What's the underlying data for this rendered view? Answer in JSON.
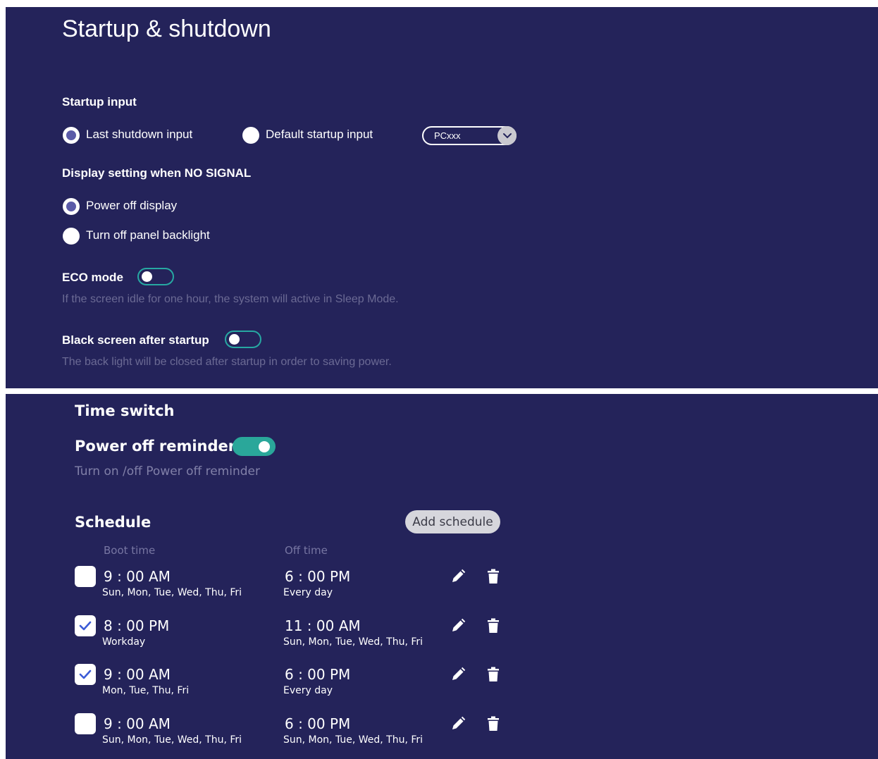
{
  "startup": {
    "title": "Startup & shutdown",
    "startup_input": {
      "label": "Startup input",
      "options": [
        {
          "label": "Last shutdown input",
          "checked": true
        },
        {
          "label": "Default startup input",
          "checked": false
        }
      ],
      "select_value": "PCxxx"
    },
    "no_signal": {
      "label": "Display setting when NO SIGNAL",
      "options": [
        {
          "label": "Power off display",
          "checked": true
        },
        {
          "label": "Turn off panel backlight",
          "checked": false
        }
      ]
    },
    "eco": {
      "label": "ECO mode",
      "enabled": false,
      "hint": "If the screen idle for one hour, the system will active in Sleep Mode."
    },
    "black_screen": {
      "label": "Black screen after startup",
      "enabled": false,
      "hint": "The back light will be closed after startup in order to saving power."
    }
  },
  "time_switch": {
    "title": "Time switch",
    "reminder": {
      "label": "Power off reminder",
      "enabled": true,
      "hint": "Turn on /off Power off reminder"
    },
    "schedule": {
      "title": "Schedule",
      "add_label": "Add schedule",
      "boot_header": "Boot time",
      "off_header": "Off time",
      "rows": [
        {
          "checked": false,
          "boot_time": "9 : 00 AM",
          "boot_days": "Sun, Mon, Tue, Wed, Thu, Fri",
          "off_time": "6 : 00 PM",
          "off_days": "Every day"
        },
        {
          "checked": true,
          "boot_time": "8 : 00 PM",
          "boot_days": "Workday",
          "off_time": "11 : 00 AM",
          "off_days": "Sun, Mon, Tue, Wed, Thu, Fri"
        },
        {
          "checked": true,
          "boot_time": "9 : 00 AM",
          "boot_days": "Mon, Tue, Thu, Fri",
          "off_time": "6 : 00 PM",
          "off_days": "Every day"
        },
        {
          "checked": false,
          "boot_time": "9 : 00 AM",
          "boot_days": "Sun, Mon, Tue, Wed, Thu, Fri",
          "off_time": "6 : 00 PM",
          "off_days": "Sun, Mon, Tue, Wed, Thu, Fri"
        }
      ]
    }
  },
  "icons": {
    "check": "check-icon",
    "edit": "pencil-icon",
    "delete": "trash-icon",
    "dropdown": "chevron-down-icon"
  },
  "colors": {
    "panel_bg": "#24235a",
    "toggle_accent": "#2aa79a",
    "radio_selected": "#5b5ba8",
    "hint_text": "#6b6a94"
  }
}
